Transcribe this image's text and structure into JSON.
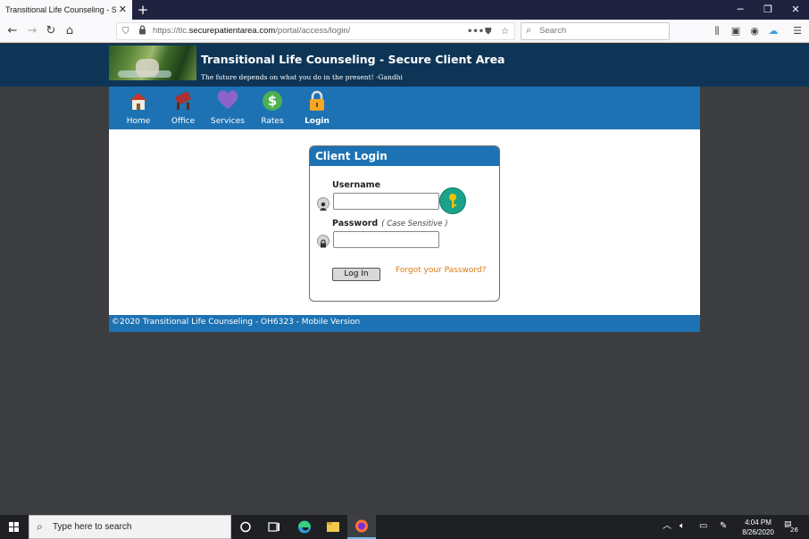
{
  "browser": {
    "tab_title": "Transitional Life Counseling - Secur",
    "url_prefix": "https://tlc.",
    "url_domain": "securepatientarea.com",
    "url_path": "/portal/access/login/",
    "search_placeholder": "Search"
  },
  "site": {
    "title": "Transitional Life Counseling - Secure Client Area",
    "tagline": "The future depends on what you do in the present! -Gandhi"
  },
  "menu": [
    {
      "label": "Home",
      "icon": "home-icon"
    },
    {
      "label": "Office",
      "icon": "office-icon"
    },
    {
      "label": "Services",
      "icon": "heart-icon"
    },
    {
      "label": "Rates",
      "icon": "dollar-icon"
    },
    {
      "label": "Login",
      "icon": "lock-icon"
    }
  ],
  "login": {
    "heading": "Client Login",
    "username_label": "Username",
    "password_label": "Password",
    "password_hint": "( Case Sensitive )",
    "login_button": "Log In",
    "forgot_link": "Forgot your Password?"
  },
  "footer": {
    "text": "©2020 Transitional Life Counseling - OH6323 - Mobile Version"
  },
  "taskbar": {
    "search_placeholder": "Type here to search",
    "time": "4:04 PM",
    "date": "8/26/2020",
    "notification_count": "26"
  },
  "colors": {
    "header_dark": "#0e3556",
    "menu_blue": "#1d72b3",
    "link_orange": "#d97b14"
  }
}
